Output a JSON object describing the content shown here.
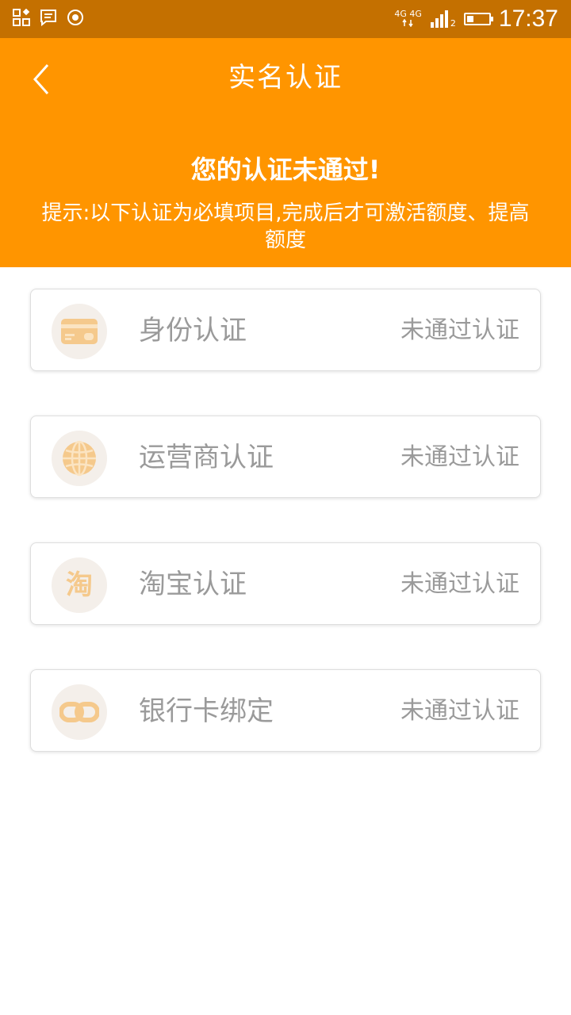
{
  "status_bar": {
    "net_top": "4G 4G",
    "sim": "2",
    "time": "17:37"
  },
  "header": {
    "title": "实名认证",
    "status": "您的认证未通过!",
    "hint": "提示:以下认证为必填项目,完成后才可激活额度、提高额度"
  },
  "items": [
    {
      "label": "身份认证",
      "status": "未通过认证",
      "icon": "id-card-icon"
    },
    {
      "label": "运营商认证",
      "status": "未通过认证",
      "icon": "globe-icon"
    },
    {
      "label": "淘宝认证",
      "status": "未通过认证",
      "icon": "taobao-icon",
      "icon_text": "淘"
    },
    {
      "label": "银行卡绑定",
      "status": "未通过认证",
      "icon": "link-icon"
    }
  ],
  "colors": {
    "status_bar": "#c47000",
    "header": "#ff9500",
    "icon_bg": "#f4efea",
    "icon_fg": "#f5c98c",
    "muted_text": "#9a9a9a"
  }
}
